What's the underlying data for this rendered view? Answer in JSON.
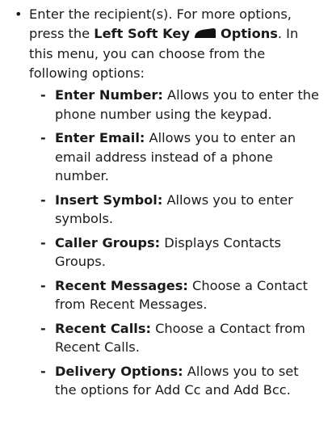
{
  "intro": {
    "bullet": "•",
    "text_before": "Enter the recipient(s). For more options, press the ",
    "key_name": "Left Soft Key",
    "key_icon": "left-soft-key-icon",
    "key_action": "Options",
    "text_after": ". In this menu, you can choose from the following options:"
  },
  "options": [
    {
      "dash": "-",
      "title": "Enter Number:",
      "desc": "Allows you to enter the phone number using the keypad."
    },
    {
      "dash": "-",
      "title": "Enter Email:",
      "desc": "Allows you to enter an email address instead of a phone number."
    },
    {
      "dash": "-",
      "title": "Insert Symbol:",
      "desc": "Allows you to enter symbols."
    },
    {
      "dash": "-",
      "title": "Caller Groups:",
      "desc": "Displays Contacts Groups."
    },
    {
      "dash": "-",
      "title": "Recent Messages:",
      "desc": "Choose a Contact from Recent Messages."
    },
    {
      "dash": "-",
      "title": "Recent Calls:",
      "desc": "Choose a Contact from Recent Calls."
    },
    {
      "dash": "-",
      "title": "Delivery Options:",
      "desc": "Allows you to set the options for Add Cc and Add Bcc."
    }
  ]
}
